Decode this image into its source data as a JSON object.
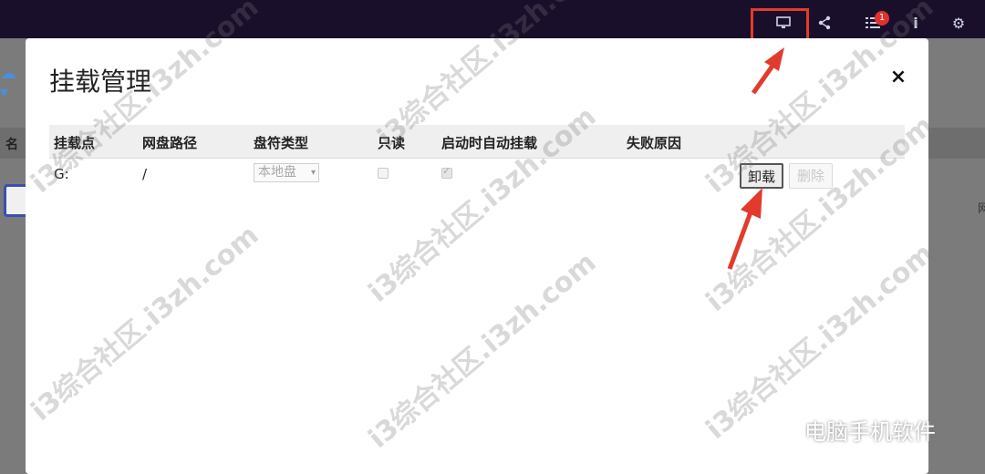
{
  "modal": {
    "title": "挂载管理",
    "close_label": "×",
    "columns": [
      "挂载点",
      "网盘路径",
      "盘符类型",
      "只读",
      "启动时自动挂载",
      "失败原因"
    ],
    "rows": [
      {
        "mount_point": "G:",
        "cloud_path": "/",
        "drive_type": "本地盘",
        "read_only": false,
        "auto_mount": true,
        "fail_reason": "",
        "unmount_label": "卸载",
        "delete_label": "删除"
      }
    ]
  },
  "header": {
    "notification_count": "1"
  },
  "background": {
    "column_label": "名"
  },
  "watermark": {
    "text": "i3综合社区.i3zh.com",
    "wechat": "电脑手机软件"
  },
  "colors": {
    "highlight": "#e23b2e",
    "header_bg": "#1a0f2a"
  }
}
